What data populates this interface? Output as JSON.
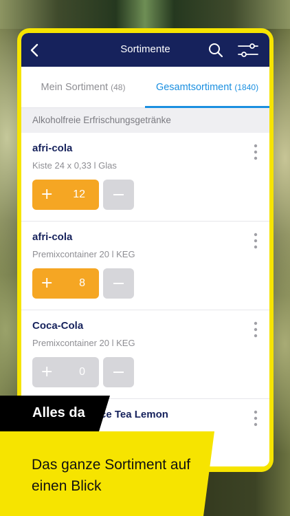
{
  "navbar": {
    "title": "Sortimente",
    "background": "#16225c"
  },
  "tabs": [
    {
      "label": "Mein Sortiment",
      "count": "(48)",
      "active": false
    },
    {
      "label": "Gesamtsortiment",
      "count": "(1840)",
      "active": true
    }
  ],
  "section": {
    "title": "Alkoholfreie Erfrischungsgetränke"
  },
  "items": [
    {
      "name": "afri-cola",
      "subtitle": "Kiste 24 x 0,33 l Glas",
      "quantity": "12",
      "plus": "+"
    },
    {
      "name": "afri-cola",
      "subtitle": "Premixcontainer 20 l KEG",
      "quantity": "8",
      "plus": "+"
    },
    {
      "name": "Coca-Cola",
      "subtitle": "Premixcontainer 20 l KEG",
      "quantity": "0",
      "plus": "+"
    },
    {
      "name": "Coca-Cola Zero Ice Tea Lemon",
      "visible_name": "ce Tea Lemon"
    }
  ],
  "promo": {
    "tagline": "Alles da",
    "headline": "Das ganze Sortiment auf einen Blick"
  },
  "colors": {
    "accent_blue": "#1a8fe0",
    "quantity_orange": "#f5a623",
    "frame_yellow": "#f6e400",
    "disabled_gray": "#d6d6da"
  },
  "icons": [
    "back-arrow-icon",
    "search-icon",
    "filter-icon",
    "more-vertical-icon",
    "plus-icon",
    "minus-icon"
  ]
}
